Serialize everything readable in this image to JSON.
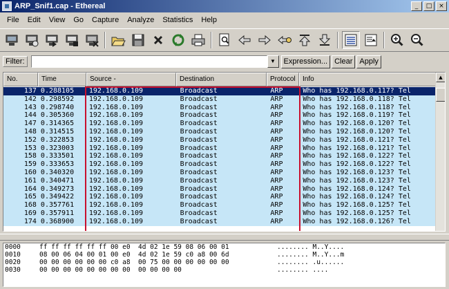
{
  "window": {
    "title": "ARP_Snif1.cap - Ethereal",
    "controls": [
      "_",
      "□",
      "×"
    ]
  },
  "menu": [
    "File",
    "Edit",
    "View",
    "Go",
    "Capture",
    "Analyze",
    "Statistics",
    "Help"
  ],
  "toolbar_icons": [
    "interfaces-icon",
    "capture-options-icon",
    "start-capture-icon",
    "restart-capture-icon",
    "stop-capture-icon",
    "open-icon",
    "save-icon",
    "close-icon",
    "reload-icon",
    "print-icon",
    "find-icon",
    "back-icon",
    "forward-icon",
    "go-to-icon",
    "first-icon",
    "last-icon",
    "colorize-icon",
    "autoscroll-icon",
    "zoom-in-icon",
    "zoom-out-icon"
  ],
  "filter": {
    "label": "Filter:",
    "value": "",
    "expression_label": "Expression...",
    "clear_label": "Clear",
    "apply_label": "Apply"
  },
  "columns": [
    "No.",
    "Time",
    "Source -",
    "Destination",
    "Protocol",
    "Info"
  ],
  "packets": [
    {
      "no": "137",
      "time": "0.288105",
      "src": "192.168.0.109",
      "dst": "Broadcast",
      "proto": "ARP",
      "info": "Who has 192.168.0.117?  Tel"
    },
    {
      "no": "142",
      "time": "0.298592",
      "src": "192.168.0.109",
      "dst": "Broadcast",
      "proto": "ARP",
      "info": "Who has 192.168.0.118?  Tel"
    },
    {
      "no": "143",
      "time": "0.298740",
      "src": "192.168.0.109",
      "dst": "Broadcast",
      "proto": "ARP",
      "info": "Who has 192.168.0.118?  Tel"
    },
    {
      "no": "144",
      "time": "0.305360",
      "src": "192.168.0.109",
      "dst": "Broadcast",
      "proto": "ARP",
      "info": "Who has 192.168.0.119?  Tel"
    },
    {
      "no": "147",
      "time": "0.314365",
      "src": "192.168.0.109",
      "dst": "Broadcast",
      "proto": "ARP",
      "info": "Who has 192.168.0.120?  Tel"
    },
    {
      "no": "148",
      "time": "0.314515",
      "src": "192.168.0.109",
      "dst": "Broadcast",
      "proto": "ARP",
      "info": "Who has 192.168.0.120?  Tel"
    },
    {
      "no": "152",
      "time": "0.322853",
      "src": "192.168.0.109",
      "dst": "Broadcast",
      "proto": "ARP",
      "info": "Who has 192.168.0.121?  Tel"
    },
    {
      "no": "153",
      "time": "0.323003",
      "src": "192.168.0.109",
      "dst": "Broadcast",
      "proto": "ARP",
      "info": "Who has 192.168.0.121?  Tel"
    },
    {
      "no": "158",
      "time": "0.333501",
      "src": "192.168.0.109",
      "dst": "Broadcast",
      "proto": "ARP",
      "info": "Who has 192.168.0.122?  Tel"
    },
    {
      "no": "159",
      "time": "0.333653",
      "src": "192.168.0.109",
      "dst": "Broadcast",
      "proto": "ARP",
      "info": "Who has 192.168.0.122?  Tel"
    },
    {
      "no": "160",
      "time": "0.340320",
      "src": "192.168.0.109",
      "dst": "Broadcast",
      "proto": "ARP",
      "info": "Who has 192.168.0.123?  Tel"
    },
    {
      "no": "161",
      "time": "0.340471",
      "src": "192.168.0.109",
      "dst": "Broadcast",
      "proto": "ARP",
      "info": "Who has 192.168.0.123?  Tel"
    },
    {
      "no": "164",
      "time": "0.349273",
      "src": "192.168.0.109",
      "dst": "Broadcast",
      "proto": "ARP",
      "info": "Who has 192.168.0.124?  Tel"
    },
    {
      "no": "165",
      "time": "0.349422",
      "src": "192.168.0.109",
      "dst": "Broadcast",
      "proto": "ARP",
      "info": "Who has 192.168.0.124?  Tel"
    },
    {
      "no": "168",
      "time": "0.357761",
      "src": "192.168.0.109",
      "dst": "Broadcast",
      "proto": "ARP",
      "info": "Who has 192.168.0.125?  Tel"
    },
    {
      "no": "169",
      "time": "0.357911",
      "src": "192.168.0.109",
      "dst": "Broadcast",
      "proto": "ARP",
      "info": "Who has 192.168.0.125?  Tel"
    },
    {
      "no": "174",
      "time": "0.368900",
      "src": "192.168.0.109",
      "dst": "Broadcast",
      "proto": "ARP",
      "info": "Who has 192.168.0.126?  Tel"
    }
  ],
  "hex_dump": [
    {
      "offset": "0000",
      "bytes": "ff ff ff ff ff ff 00 e0  4d 02 1e 59 08 06 00 01",
      "ascii": "........ M..Y...."
    },
    {
      "offset": "0010",
      "bytes": "08 00 06 04 00 01 00 e0  4d 02 1e 59 c0 a8 00 6d",
      "ascii": "........ M..Y...m"
    },
    {
      "offset": "0020",
      "bytes": "00 00 00 00 00 00 c0 a8  00 75 00 00 00 00 00 00",
      "ascii": "........ .u......"
    },
    {
      "offset": "0030",
      "bytes": "00 00 00 00 00 00 00 00  00 00 00 00",
      "ascii": "........ ...."
    }
  ],
  "colors": {
    "row_background": "#c6e6f7",
    "selected_row": "#0a246a",
    "highlight_box": "#c8102e",
    "title_gradient_start": "#0a246a"
  }
}
